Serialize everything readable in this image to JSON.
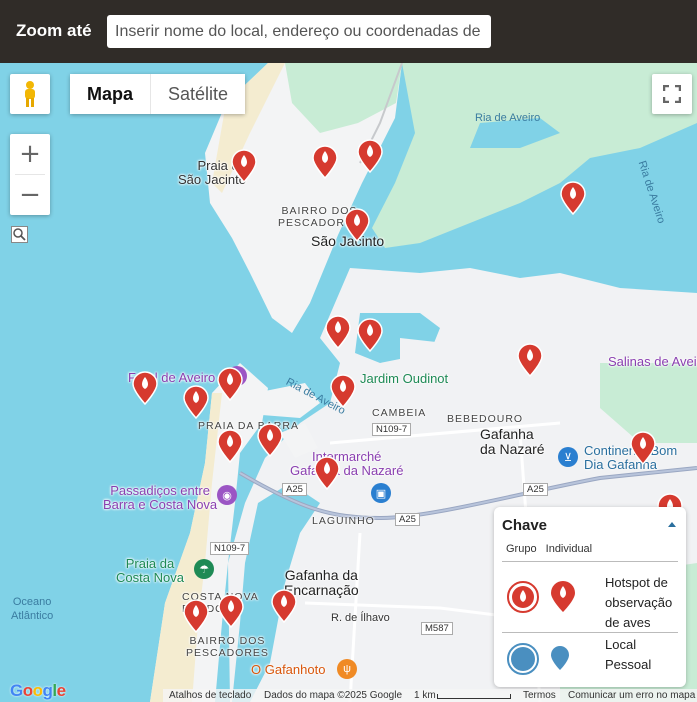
{
  "header": {
    "zoom_label": "Zoom até",
    "search_placeholder": "Inserir nome do local, endereço ou coordenadas de lat"
  },
  "map_controls": {
    "map_type_options": [
      "Mapa",
      "Satélite"
    ],
    "selected_map_type": "Mapa",
    "zoom_in": "+",
    "zoom_out": "−"
  },
  "hotspots_count": 22,
  "places": {
    "praia_sao_jacinto": "Praia de\nSão Jacinto",
    "bairro_pescadores_n": "BAIRRO DOS\nPESCADORES",
    "sao_jacinto": "São Jacinto",
    "ria_aveiro_1": "Ria de Aveiro",
    "ria_aveiro_2": "Ria de Aveiro",
    "ria_aveiro_3": "Ria de Aveiro",
    "salinas": "Salinas de Aveiro",
    "farol": "Farol de Aveiro",
    "jardim": "Jardim Oudinot",
    "cambeia": "CAMBEIA",
    "bebedouro": "BEBEDOURO",
    "gafanha_nazare": "Gafanha\nda Nazaré",
    "continente": "Continente Bom\nDia Gafanha",
    "praia_barra": "PRAIA DA BARRA",
    "intermarche": "Intermarché\nGafanha da Nazaré",
    "passadicos": "Passadiços entre\nBarra e Costa Nova",
    "laguinho": "LAGUINHO",
    "praia_costa_nova": "Praia da\nCosta Nova",
    "costa_nova_prado": "COSTA NOVA\nPRADO",
    "gafanha_encarnacao": "Gafanha da\nEncarnação",
    "r_ilhavo": "R. de Ílhavo",
    "oceano": "Oceano\nAtlântico",
    "bairro_pescadores_s": "BAIRRO DOS\nPESCADORES",
    "gafanhoto": "O Gafanhoto",
    "roads": [
      "N109-7",
      "A25",
      "A25",
      "A25",
      "N109-7",
      "M587"
    ]
  },
  "legend": {
    "title": "Chave",
    "columns": [
      "Grupo",
      "Individual"
    ],
    "rows": [
      {
        "label": "Hotspot de\nobservação\nde aves",
        "color": "#d63a2f"
      },
      {
        "label": "Local\nPessoal",
        "color": "#4a8fc0"
      }
    ]
  },
  "footer": {
    "keyboard": "Atalhos de teclado",
    "map_data": "Dados do mapa ©2025 Google",
    "scale": "1 km",
    "terms": "Termos",
    "report": "Comunicar um erro no mapa",
    "logo": "Google"
  },
  "colors": {
    "water": "#7fd1e6",
    "land": "#f2f3f4",
    "green": "#c9ecd6",
    "sand": "#f5ecd2",
    "hotspot": "#d63a2f",
    "header": "#302c28"
  }
}
